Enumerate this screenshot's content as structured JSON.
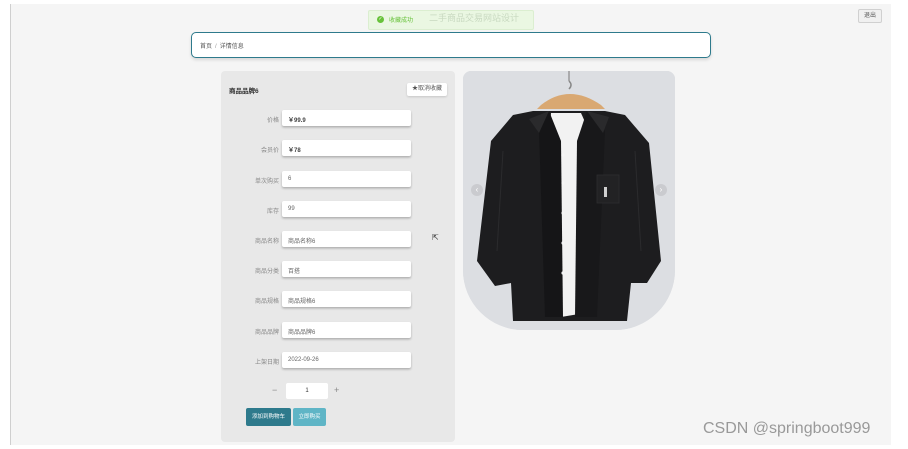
{
  "header": {
    "logout_label": "退出"
  },
  "toast": {
    "ghost_title": "二手商品交易网站设计",
    "message": "收藏成功"
  },
  "breadcrumb": {
    "home": "首页",
    "separator": "/",
    "current": "详情信息"
  },
  "product": {
    "title": "商品品牌6",
    "favorite_label": "★取消收藏",
    "fields": [
      {
        "label": "价格",
        "value": "￥99.9"
      },
      {
        "label": "会员价",
        "value": "￥78"
      },
      {
        "label": "单次购买",
        "value": "6"
      },
      {
        "label": "库存",
        "value": "99"
      },
      {
        "label": "商品名称",
        "value": "商品名称6"
      },
      {
        "label": "商品分类",
        "value": "百搭"
      },
      {
        "label": "商品规格",
        "value": "商品规格6"
      },
      {
        "label": "商品品牌",
        "value": "商品品牌6"
      },
      {
        "label": "上架日期",
        "value": "2022-09-26"
      }
    ],
    "quantity": {
      "minus": "−",
      "value": "1",
      "plus": "+"
    },
    "add_to_cart_label": "添加到购物车",
    "buy_now_label": "立即购买"
  },
  "carousel": {
    "prev": "‹",
    "next": "›",
    "image_icon": "black-shirt-photo"
  },
  "watermark": "CSDN @springboot999",
  "colors": {
    "accent": "#2e7a8c",
    "accent_light": "#5fb5c6",
    "success": "#67c23a"
  }
}
